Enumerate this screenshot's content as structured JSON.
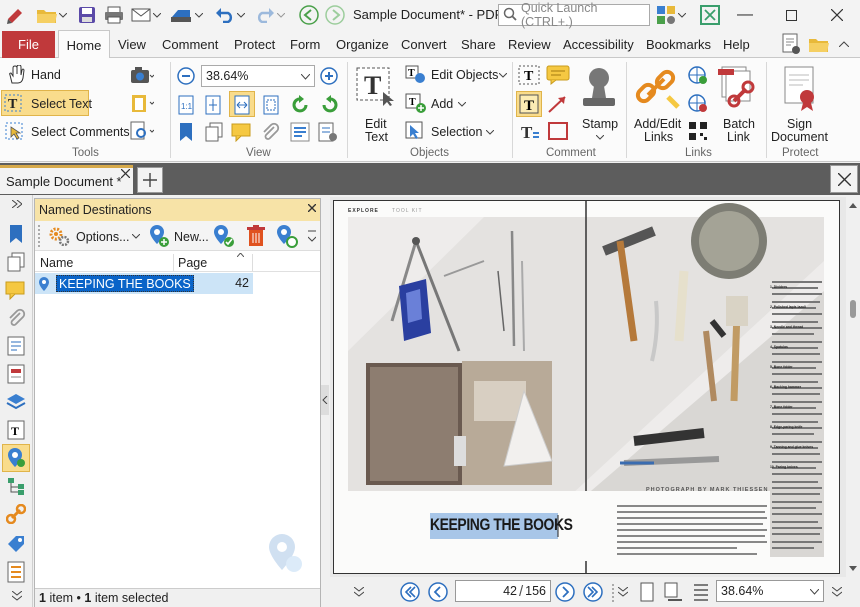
{
  "titlebar": {
    "document_title": "Sample Document* - PDF...",
    "quick_launch_placeholder": "Quick Launch (CTRL+.)"
  },
  "menu": {
    "file": "File",
    "tabs": [
      "Home",
      "View",
      "Comment",
      "Protect",
      "Form",
      "Organize",
      "Convert",
      "Share",
      "Review",
      "Accessibility",
      "Bookmarks",
      "Help"
    ]
  },
  "ribbon": {
    "tools": {
      "hand": "Hand",
      "select_text": "Select Text",
      "select_comments": "Select Comments",
      "group": "Tools"
    },
    "view": {
      "zoom": "38.64%",
      "group": "View"
    },
    "objects": {
      "edit_text_1": "Edit",
      "edit_text_2": "Text",
      "edit_objects": "Edit Objects",
      "add": "Add",
      "selection": "Selection",
      "group": "Objects"
    },
    "comment": {
      "stamp": "Stamp",
      "group": "Comment"
    },
    "links": {
      "add_edit_1": "Add/Edit",
      "add_edit_2": "Links",
      "batch_1": "Batch",
      "batch_2": "Link",
      "group": "Links"
    },
    "protect": {
      "sign_1": "Sign",
      "sign_2": "Document",
      "group": "Protect"
    }
  },
  "doc_tab": {
    "label": "Sample Document *"
  },
  "panel": {
    "title": "Named Destinations",
    "options": "Options...",
    "new": "New...",
    "columns": {
      "name": "Name",
      "page": "Page"
    },
    "rows": [
      {
        "name": "KEEPING THE BOOKS",
        "page": "42"
      }
    ],
    "status": {
      "items_count": "1",
      "items_word": "item",
      "selected_count": "1",
      "selected_word": "item selected"
    }
  },
  "page_content": {
    "header_left": "EXPLORE",
    "header_right": "TOOL KIT",
    "headline": "KEEPING THE BOOKS",
    "photo_credit": "PHOTOGRAPH BY MARK THIESSEN",
    "sidebar_items": [
      "1. Dividers",
      "2. Polished lapis lazuli",
      "3. Needle and thread",
      "4. Spatulas",
      "5. Bone folder",
      "6. Backing hammer",
      "7. Bone folder",
      "8. Edge-paring knife",
      "9. Tanning and glue knives",
      "10. Paring knives"
    ]
  },
  "navbar": {
    "current_page": "42",
    "total_pages": "156",
    "zoom": "38.64%"
  },
  "colors": {
    "file_tab": "#c0393b",
    "accent_gold": "#d6a94a",
    "panel_header": "#f7e3a7",
    "selection": "#cce4f7"
  }
}
